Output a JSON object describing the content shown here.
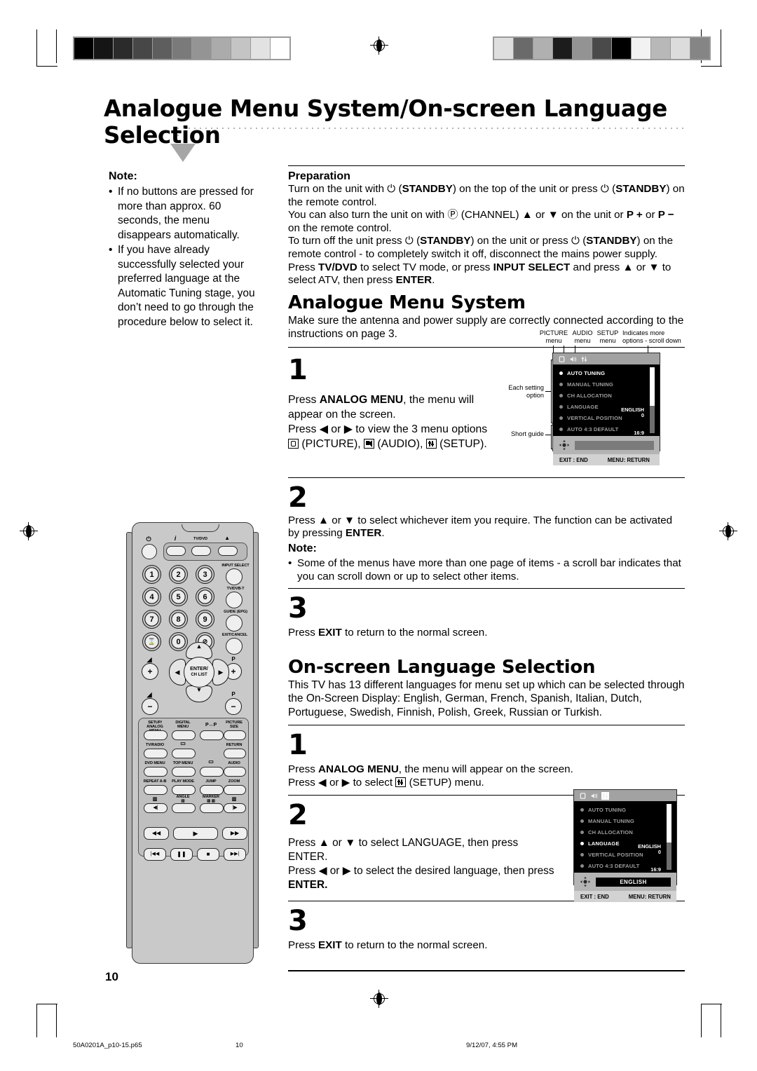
{
  "header": {
    "title": "Analogue Menu System/On-screen Language Selection"
  },
  "note_left": {
    "heading": "Note:",
    "bullet": "•",
    "items": [
      "If no buttons are pressed for more than approx. 60 seconds, the menu disappears automatically.",
      "If you have already successfully selected your preferred language at the Automatic Tuning stage, you don’t need to go through the procedure below to select it."
    ]
  },
  "preparation": {
    "heading": "Preparation",
    "lines": [
      "Turn on the unit with ⏻ (STANDBY) on the top of the unit or press ⏻ (STANDBY) on the remote control.",
      "You can also turn the unit on with Ⓟ (CHANNEL) ▲ or ▼ on the unit or P + or P − on the remote control.",
      "To turn off the unit press ⏻ (STANDBY) on the unit or press ⏻ (STANDBY) on the remote control - to completely switch it off, disconnect the mains power supply.",
      "Press TV/DVD to select TV mode, or press INPUT SELECT and press ▲ or ▼ to select ATV, then press ENTER."
    ]
  },
  "analogue_menu": {
    "title": "Analogue Menu System",
    "subtitle": "Make sure the antenna and power supply are correctly connected according to the instructions on page 3.",
    "steps": [
      {
        "num": "1",
        "lines": [
          "Press ANALOG MENU, the menu will appear on the screen.",
          "Press ◀ or ▶ to view the 3 menu options (PICTURE), (AUDIO), (SETUP)."
        ],
        "labels": {
          "picture": "(PICTURE),",
          "audio": "(AUDIO),",
          "setup": "(SETUP)."
        }
      },
      {
        "num": "2",
        "body": "Press ▲ or ▼ to select whichever item you require. The function can be activated by pressing ENTER.",
        "note_heading": "Note:",
        "note_bullet": "•",
        "note_text": "Some of the menus have more than one page of items - a scroll bar indicates that you can scroll down or up to select other items."
      },
      {
        "num": "3",
        "body": "Press EXIT to return to the normal screen."
      }
    ]
  },
  "language_section": {
    "title": "On-screen Language Selection",
    "subtitle": "This TV has 13 different languages for menu set up which can be selected through the On-Screen Display: English, German, French, Spanish, Italian, Dutch, Portuguese, Swedish, Finnish, Polish, Greek, Russian or Turkish.",
    "steps": [
      {
        "num": "1",
        "line1": "Press ANALOG MENU, the menu will appear on the screen.",
        "line2_pre": "Press ◀ or ▶ to select",
        "line2_post": "(SETUP) menu."
      },
      {
        "num": "2",
        "line1": "Press ▲ or ▼ to select LANGUAGE, then press ENTER.",
        "line2": "Press ◀ or ▶ to select the desired language, then press",
        "line3": "ENTER."
      },
      {
        "num": "3",
        "body": "Press EXIT to return to the normal screen."
      }
    ]
  },
  "osd_one": {
    "callouts": {
      "picture_menu": "PICTURE\nmenu",
      "audio_menu": "AUDIO\nmenu",
      "setup_menu": "SETUP\nmenu",
      "scroll": "Indicates more\noptions - scroll down",
      "each_setting": "Each setting\noption",
      "short_guide": "Short guide"
    },
    "tabs": [
      "picture-tab",
      "audio-tab",
      "setup-tab"
    ],
    "selected_tab": -1,
    "rows": [
      {
        "label": "AUTO TUNING",
        "value": "",
        "active": true
      },
      {
        "label": "MANUAL TUNING",
        "value": "",
        "active": false
      },
      {
        "label": "CH ALLOCATION",
        "value": "",
        "active": false
      },
      {
        "label": "LANGUAGE",
        "value": "ENGLISH",
        "active": false
      },
      {
        "label": "VERTICAL POSITION",
        "value": "0",
        "active": false
      },
      {
        "label": "AUTO 4:3 DEFAULT",
        "value": "16:9",
        "active": false
      }
    ],
    "guide_value": "",
    "footer_left": "EXIT : END",
    "footer_right": "MENU: RETURN"
  },
  "osd_two": {
    "tabs": [
      "picture-tab",
      "audio-tab",
      "setup-tab"
    ],
    "selected_tab": 2,
    "rows": [
      {
        "label": "AUTO TUNING",
        "value": "",
        "active": false
      },
      {
        "label": "MANUAL TUNING",
        "value": "",
        "active": false
      },
      {
        "label": "CH ALLOCATION",
        "value": "",
        "active": false
      },
      {
        "label": "LANGUAGE",
        "value": "ENGLISH",
        "active": true
      },
      {
        "label": "VERTICAL POSITION",
        "value": "0",
        "active": false
      },
      {
        "label": "AUTO 4:3 DEFAULT",
        "value": "16:9",
        "active": false
      }
    ],
    "guide_value": "ENGLISH",
    "footer_left": "EXIT : END",
    "footer_right": "MENU: RETURN"
  },
  "remote": {
    "top_labels": {
      "power": "⏻",
      "info": "i",
      "tvdvd": "TV/DVD",
      "eject": "▲"
    },
    "side_labels": [
      "INPUT SELECT",
      "TV/DVB-T",
      "GUIDE (EPG)",
      "EXIT/CANCEL"
    ],
    "numbers": [
      "1",
      "2",
      "3",
      "4",
      "5",
      "6",
      "7",
      "8",
      "9"
    ],
    "bottom_number_row": [
      "⌛",
      "0",
      "⊘"
    ],
    "volume_up": "+",
    "volume_down": "−",
    "prog_up": "+",
    "prog_down": "−",
    "prog_label": "P",
    "enter_label": "ENTER/",
    "chlist_label": "CH LIST",
    "function_rows": [
      [
        "SETUP/\nANALOG MENU",
        "DIGITAL\nMENU",
        "P↔P",
        "PICTURE\nSIZE"
      ],
      [
        "TV/RADIO",
        "▭",
        "",
        "RETURN"
      ],
      [
        "DVD MENU",
        "TOP MENU",
        "▭",
        "AUDIO"
      ],
      [
        "REPEAT A-B",
        "PLAY MODE",
        "JUMP",
        "ZOOM"
      ],
      [
        "",
        "ANGLE",
        "MARKER",
        ""
      ]
    ],
    "transport_row1": [
      "◀◀",
      "▶",
      "▶▶"
    ],
    "transport_row2": [
      "|◀◀",
      "❚❚",
      "■",
      "▶▶|"
    ]
  },
  "footer": {
    "page_number": "10",
    "file_name": "50A0201A_p10-15.p65",
    "sheet_number": "10",
    "timestamp": "9/12/07, 4:55 PM"
  },
  "calibration": {
    "left_strip": [
      "#000000",
      "#151515",
      "#2b2b2b",
      "#474747",
      "#5e5e5e",
      "#7a7a7a",
      "#949494",
      "#ababab",
      "#c4c4c4",
      "#e2e2e2",
      "#ffffff"
    ],
    "right_strip": [
      "#dedede",
      "#6a6a6a",
      "#b0b0b0",
      "#1c1c1c",
      "#939393",
      "#4a4a4a",
      "#000000",
      "#f2f2f2",
      "#b8b8b8",
      "#dcdcdc",
      "#858585"
    ]
  }
}
